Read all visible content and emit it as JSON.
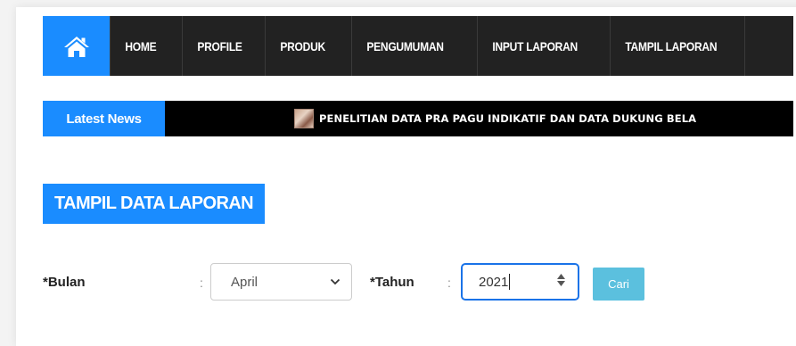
{
  "nav": {
    "home_icon": "home-icon",
    "items": [
      "HOME",
      "PROFILE",
      "PRODUK",
      "PENGUMUMAN",
      "INPUT LAPORAN",
      "TAMPIL LAPORAN"
    ],
    "accent": "#1a8cff"
  },
  "news": {
    "label": "Latest News",
    "headline": "PENELITIAN DATA PRA PAGU INDIKATIF DAN DATA DUKUNG BELA"
  },
  "page": {
    "title": "TAMPIL DATA LAPORAN"
  },
  "form": {
    "bulan_label": "*Bulan",
    "colon": ":",
    "bulan_value": "April",
    "tahun_label": "*Tahun",
    "tahun_value": "2021",
    "submit_label": "Cari"
  }
}
